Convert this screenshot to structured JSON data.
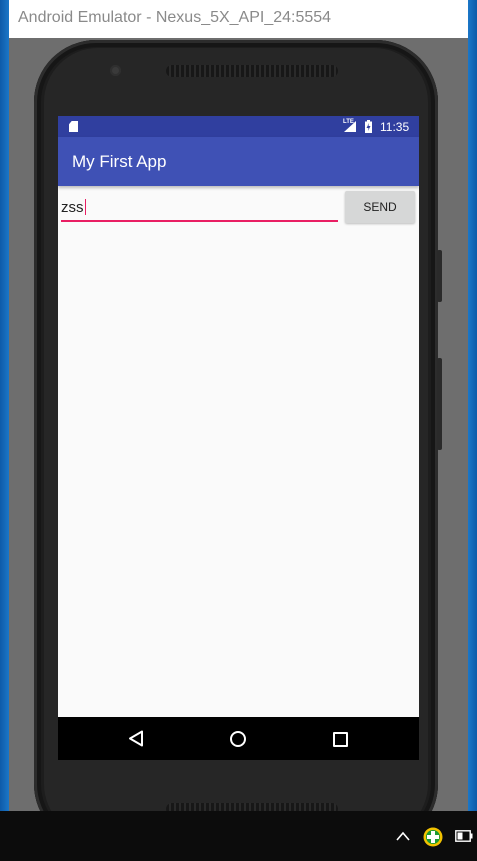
{
  "window": {
    "title": "Android Emulator - Nexus_5X_API_24:5554"
  },
  "statusbar": {
    "network_label": "LTE",
    "time": "11:35"
  },
  "app": {
    "title": "My First App"
  },
  "message_input": {
    "value": "zss"
  },
  "send_button": {
    "label": "SEND"
  },
  "colors": {
    "status_bar": "#303f9f",
    "app_bar": "#3f51b5",
    "accent": "#e91e63",
    "screen_background": "#fafafa",
    "button_background": "#d6d7d7"
  },
  "icons": {
    "status": [
      "sd-card-icon",
      "lte-signal-icon",
      "battery-charging-icon"
    ],
    "navigation": [
      "back-icon",
      "home-icon",
      "recents-icon"
    ],
    "tray": [
      "chevron-up-icon",
      "plus-circle-icon",
      "battery-icon"
    ]
  }
}
